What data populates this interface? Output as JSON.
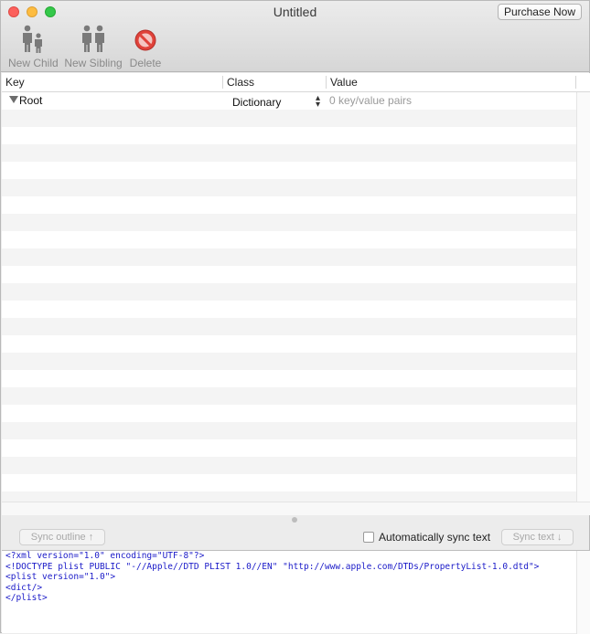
{
  "window": {
    "title": "Untitled"
  },
  "toolbar": {
    "purchase_label": "Purchase Now",
    "new_child_label": "New Child",
    "new_sibling_label": "New Sibling",
    "delete_label": "Delete"
  },
  "table": {
    "columns": [
      "Key",
      "Class",
      "Value"
    ],
    "root": {
      "key": "Root",
      "class": "Dictionary",
      "value": "0 key/value pairs"
    }
  },
  "sync": {
    "sync_outline_label": "Sync outline ↑",
    "auto_sync_label": "Automatically sync text",
    "auto_sync_checked": false,
    "sync_text_label": "Sync text ↓"
  },
  "editor": {
    "lines": [
      "<?xml version=\"1.0\" encoding=\"UTF-8\"?>",
      "<!DOCTYPE plist PUBLIC \"-//Apple//DTD PLIST 1.0//EN\" \"http://www.apple.com/DTDs/PropertyList-1.0.dtd\">",
      "<plist version=\"1.0\">",
      "<dict/>",
      "</plist>"
    ]
  },
  "colors": {
    "close": "#fc605c",
    "minimize": "#fdbc40",
    "maximize": "#34c84a",
    "xml_text": "#1a1ac8",
    "delete_icon": "#e0423a"
  }
}
